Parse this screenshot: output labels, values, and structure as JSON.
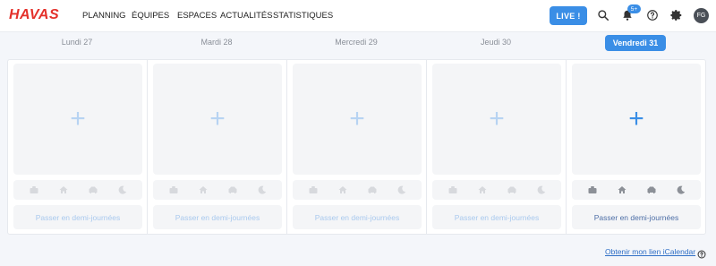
{
  "header": {
    "logo": "HAVAS",
    "nav": [
      "PLANNING",
      "ÉQUIPES",
      "ESPACES",
      "ACTUALITÉS",
      "STATISTIQUES"
    ],
    "live_label": "LIVE !",
    "notif_badge": "5+",
    "avatar_initials": "FG",
    "icons": [
      "search-icon",
      "bell-icon",
      "help-icon",
      "gear-icon"
    ]
  },
  "days": [
    {
      "label": "Lundi 27",
      "active": false,
      "action": "Passer en demi-journées"
    },
    {
      "label": "Mardi 28",
      "active": false,
      "action": "Passer en demi-journées"
    },
    {
      "label": "Mercredi 29",
      "active": false,
      "action": "Passer en demi-journées"
    },
    {
      "label": "Jeudi 30",
      "active": false,
      "action": "Passer en demi-journées"
    },
    {
      "label": "Vendredi 31",
      "active": true,
      "action": "Passer en demi-journées"
    }
  ],
  "slot_icons": [
    "briefcase-icon",
    "home-icon",
    "car-icon",
    "moon-icon"
  ],
  "footer": {
    "ical_link": "Obtenir mon lien iCalendar"
  },
  "colors": {
    "accent": "#3a8ee6",
    "brand_red": "#e4312b"
  }
}
